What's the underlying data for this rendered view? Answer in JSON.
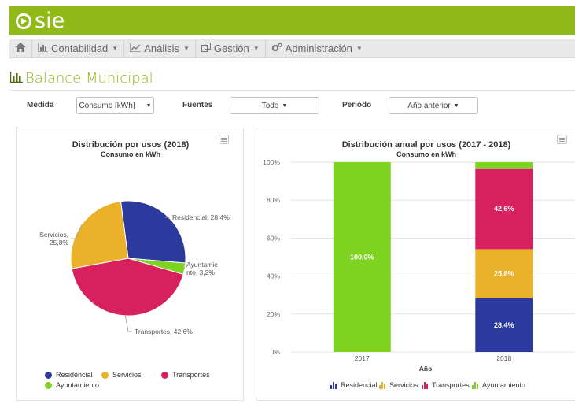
{
  "app": {
    "brand": "sie"
  },
  "nav": {
    "items": [
      {
        "label": "Contabilidad",
        "icon": "bar-chart-icon"
      },
      {
        "label": "Análisis",
        "icon": "line-chart-icon"
      },
      {
        "label": "Gestión",
        "icon": "clone-icon"
      },
      {
        "label": "Administración",
        "icon": "cogs-icon"
      }
    ]
  },
  "page": {
    "title": "Balance Municipal"
  },
  "filters": {
    "medida_label": "Medida",
    "medida_value": "Consumo [kWh]",
    "fuentes_label": "Fuentes",
    "fuentes_value": "Todo",
    "periodo_label": "Periodo",
    "periodo_value": "Año anterior"
  },
  "colors": {
    "residencial": "#2b3a9c",
    "servicios": "#ebb12b",
    "transportes": "#d8205f",
    "ayuntamiento": "#7ed321",
    "brand": "#8fba17"
  },
  "chart_data": [
    {
      "type": "pie",
      "title": "Distribución por usos (2018)",
      "subtitle": "Consumo en kWh",
      "slices": [
        {
          "name": "Residencial",
          "value": 28.4,
          "label_a": "Residencial, 28,4%"
        },
        {
          "name": "Ayuntamiento",
          "value": 3.2,
          "label_a": "Ayuntamie",
          "label_b": "nto, 3,2%"
        },
        {
          "name": "Transportes",
          "value": 42.6,
          "label_a": "Transportes, 42,6%"
        },
        {
          "name": "Servicios",
          "value": 25.8,
          "label_a": "Servicios,",
          "label_b": "25,8%"
        }
      ],
      "legend": [
        "Residencial",
        "Servicios",
        "Transportes",
        "Ayuntamiento"
      ]
    },
    {
      "type": "bar",
      "stacked": "percent",
      "title": "Distribución anual por usos (2017 - 2018)",
      "subtitle": "Consumo en kWh",
      "xlabel": "Año",
      "categories": [
        "2017",
        "2018"
      ],
      "ylim": [
        0,
        100
      ],
      "yticks": [
        "0%",
        "20%",
        "40%",
        "60%",
        "80%",
        "100%"
      ],
      "series": [
        {
          "name": "Residencial",
          "values": [
            0,
            28.4
          ],
          "labels": [
            "",
            "28,4%"
          ]
        },
        {
          "name": "Servicios",
          "values": [
            0,
            25.8
          ],
          "labels": [
            "",
            "25,8%"
          ]
        },
        {
          "name": "Transportes",
          "values": [
            0,
            42.6
          ],
          "labels": [
            "",
            "42,6%"
          ]
        },
        {
          "name": "Ayuntamiento",
          "values": [
            100,
            3.2
          ],
          "labels": [
            "100,0%",
            ""
          ]
        }
      ],
      "legend": [
        "Residencial",
        "Servicios",
        "Transportes",
        "Ayuntamiento"
      ]
    }
  ]
}
